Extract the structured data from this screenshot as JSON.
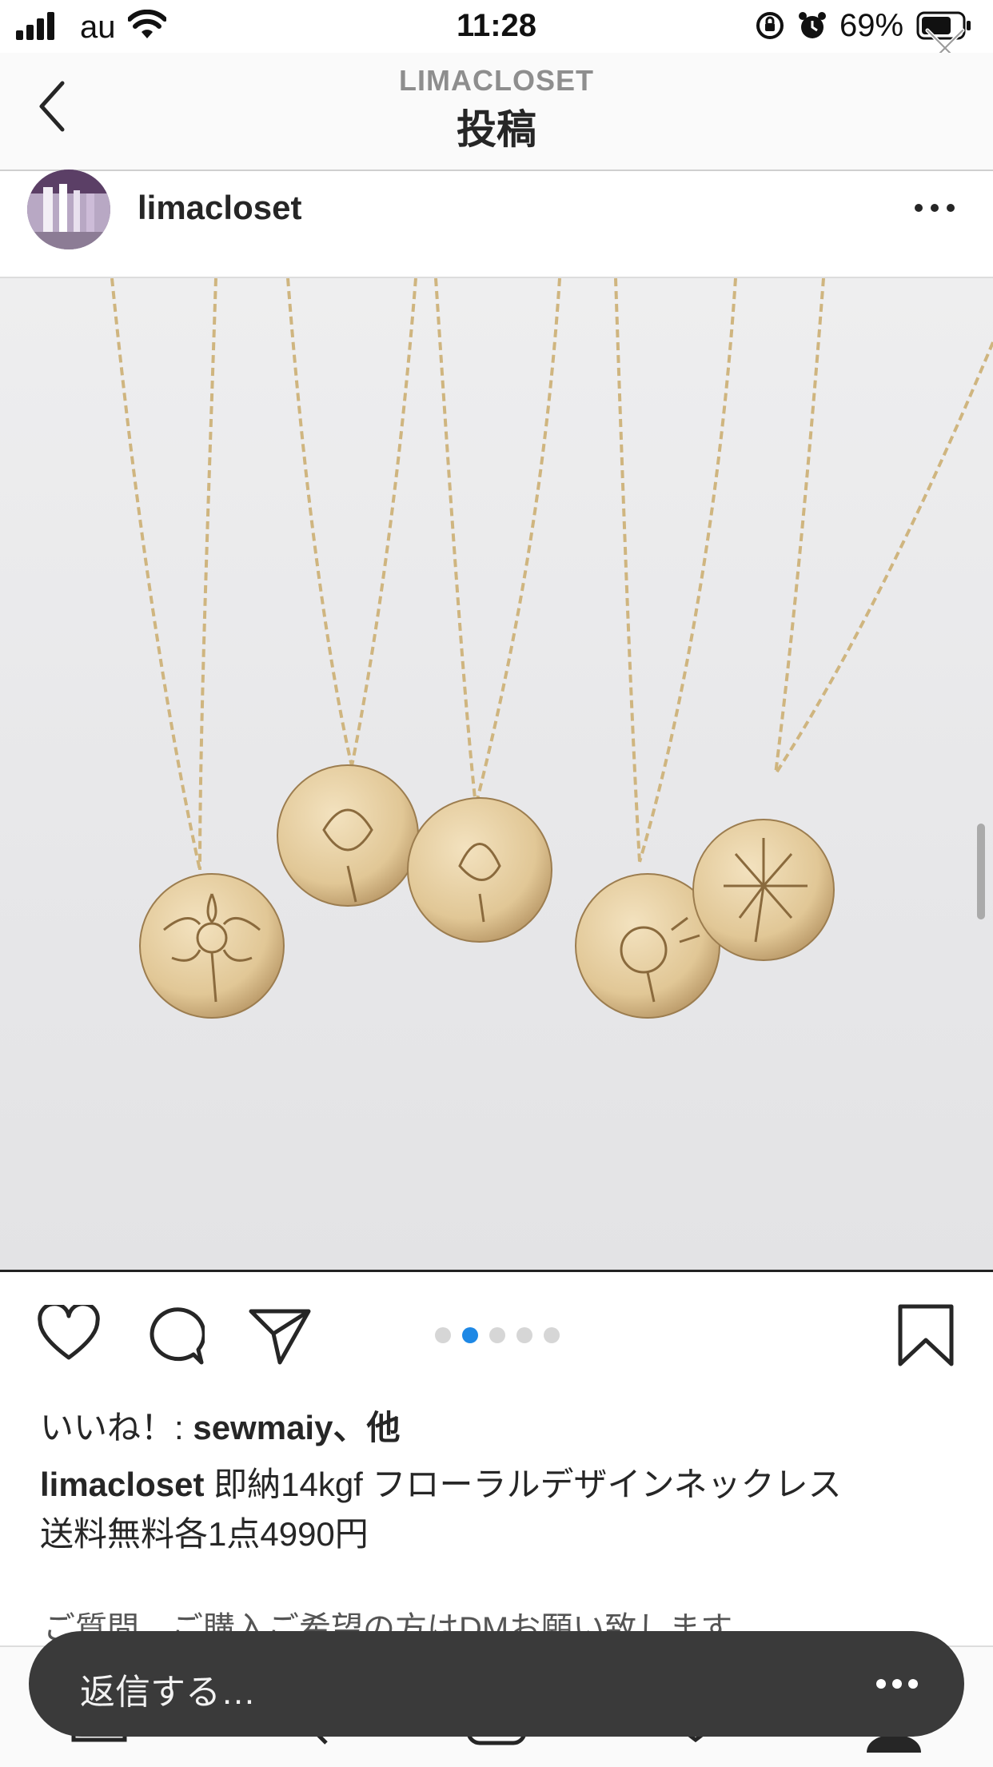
{
  "status_bar": {
    "carrier": "au",
    "time": "11:28",
    "battery": "69%"
  },
  "header": {
    "account": "LIMACLOSET",
    "title": "投稿"
  },
  "post": {
    "username": "limacloset",
    "likes_prefix": "いいね！: ",
    "likes_user": "sewmaiy、他",
    "caption_user": "limacloset",
    "caption_line1": "即納14kgf フローラルデザインネックレス",
    "caption_line2": "送料無料各1点4990円",
    "caption_line3": "ご質問、ご購入ご希望の方はDMお願い致します",
    "carousel": {
      "count": 5,
      "active": 2
    }
  },
  "reply": {
    "placeholder": "返信する…"
  },
  "icons": {
    "back": "chevron-left-icon",
    "close": "close-icon",
    "more": "more-horizontal-icon",
    "like": "heart-icon",
    "comment": "comment-icon",
    "share": "paper-plane-icon",
    "save": "bookmark-icon"
  },
  "colors": {
    "active_dot": "#1e88e5",
    "reply_bar": "#3a3a3a"
  }
}
